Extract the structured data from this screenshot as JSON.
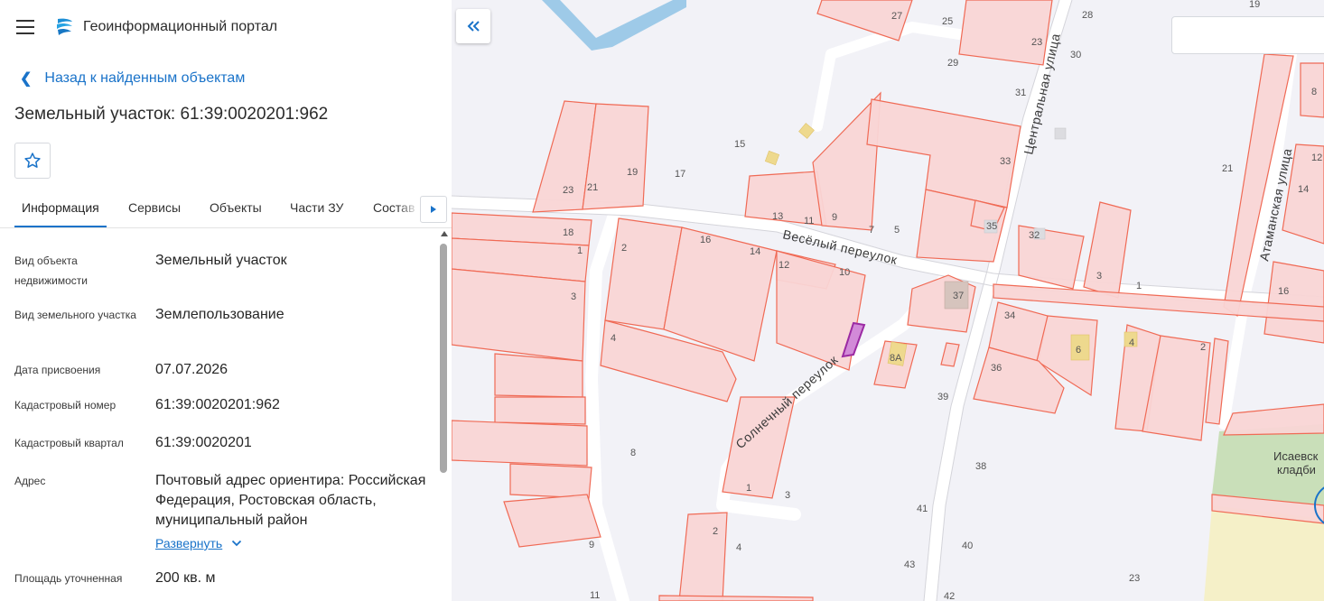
{
  "header": {
    "title": "Геоинформационный портал"
  },
  "nav": {
    "back_label": "Назад к найденным объектам"
  },
  "object": {
    "title": "Земельный участок: 61:39:0020201:962"
  },
  "tabs": [
    {
      "label": "Информация"
    },
    {
      "label": "Сервисы"
    },
    {
      "label": "Объекты"
    },
    {
      "label": "Части ЗУ"
    },
    {
      "label": "Состав"
    }
  ],
  "info": {
    "rows": [
      {
        "label": "Вид объекта недвижимости",
        "value": "Земельный участок"
      },
      {
        "label": "Вид земельного участка",
        "value": "Землепользование"
      },
      {
        "label": "Дата присвоения",
        "value": "07.07.2026"
      },
      {
        "label": "Кадастровый номер",
        "value": "61:39:0020201:962"
      },
      {
        "label": "Кадастровый квартал",
        "value": "61:39:0020201"
      },
      {
        "label": "Адрес",
        "value": "Почтовый адрес ориентира: Российская Федерация, Ростовская область, муниципальный район"
      },
      {
        "label": "Площадь уточненная",
        "value": "200 кв. м"
      }
    ],
    "expand_label": "Развернуть"
  },
  "map": {
    "search": {
      "value": "",
      "placeholder": ""
    },
    "streets": [
      {
        "name": "Весёлый переулок"
      },
      {
        "name": "Солнечный переулок"
      },
      {
        "name": "Центральная улица"
      },
      {
        "name": "Атаманская улица"
      }
    ],
    "area_label": {
      "line1": "Исаевск",
      "line2": "кладби"
    },
    "house_numbers": [
      "27",
      "25",
      "28",
      "19",
      "23",
      "29",
      "30",
      "31",
      "8",
      "15",
      "33",
      "21",
      "12",
      "19",
      "17",
      "23",
      "21",
      "14",
      "13",
      "11",
      "9",
      "7",
      "5",
      "35",
      "32",
      "18",
      "1",
      "2",
      "16",
      "14",
      "12",
      "10",
      "3",
      "1",
      "16",
      "37",
      "34",
      "6",
      "4",
      "2",
      "3",
      "4",
      "8А",
      "36",
      "39",
      "8",
      "38",
      "1",
      "3",
      "41",
      "2",
      "4",
      "9",
      "40",
      "43",
      "23",
      "11",
      "42"
    ]
  },
  "colors": {
    "accent": "#1a73c9",
    "parcel_fill": "#f9d5d5",
    "parcel_stroke": "#f06a55",
    "selected_parcel": "#b046b8",
    "map_background": "#f2f2f7",
    "road": "#ffffff",
    "water": "#9ecae8",
    "cemetery": "#c9dfb9"
  },
  "icons": {
    "menu": "menu-icon",
    "logo": "logo-icon",
    "back": "chevron-left-icon",
    "favorite": "star-icon",
    "tabs_next": "caret-right-icon",
    "expand": "chevron-down-icon",
    "collapse_panel": "double-chevron-left-icon"
  }
}
